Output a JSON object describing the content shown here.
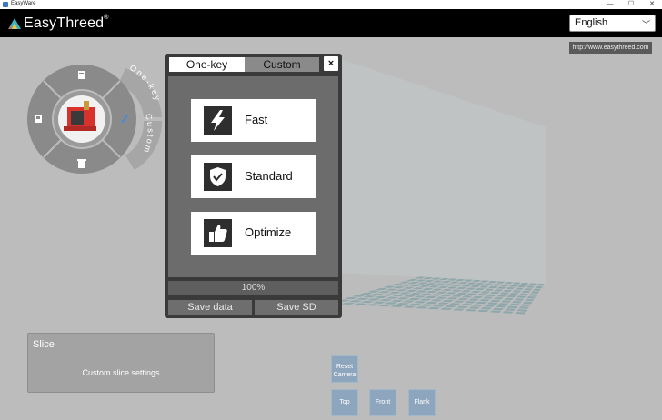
{
  "window": {
    "title": "EasyWare",
    "minimize": "—",
    "maximize": "☐",
    "close": "✕"
  },
  "header": {
    "brand": "EasyThreed",
    "brand_mark": "®",
    "language": "English",
    "url": "http://www.easythreed.com"
  },
  "wheel": {
    "outer_top": "One-key",
    "outer_bottom": "Custom",
    "icons": [
      "document-icon",
      "save-icon",
      "trash-icon",
      "pencil-icon"
    ]
  },
  "panel": {
    "tabs": [
      "One-key",
      "Custom"
    ],
    "close": "×",
    "modes": [
      {
        "label": "Fast",
        "icon": "lightning-icon"
      },
      {
        "label": "Standard",
        "icon": "shield-check-icon"
      },
      {
        "label": "Optimize",
        "icon": "thumbs-up-icon"
      }
    ],
    "progress": "100%",
    "save_data": "Save data",
    "save_sd": "Save SD"
  },
  "slice": {
    "title": "Slice",
    "subtitle": "Custom slice settings"
  },
  "camera": {
    "reset_line1": "Reset",
    "reset_line2": "Camera",
    "top": "Top",
    "front": "Front",
    "flank": "Flank"
  },
  "colors": {
    "background": "#bcbcbc",
    "header": "#000000",
    "camera_button": "#8ea6bd",
    "bed_tile": "#7ea0a4"
  }
}
